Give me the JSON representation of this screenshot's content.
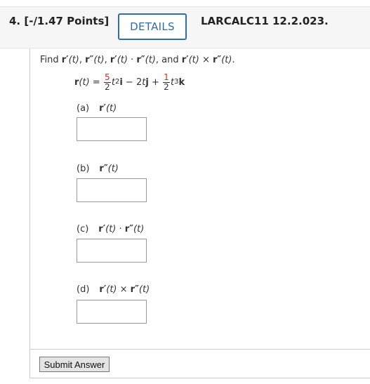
{
  "header": {
    "question_number": "4.",
    "points": "[-/1.47 Points]",
    "details_label": "DETAILS",
    "assignment_id": "LARCALC11 12.2.023."
  },
  "problem": {
    "find_prefix": "Find ",
    "find_mid1": ", ",
    "find_mid2": ", ",
    "find_mid3": ", and ",
    "find_end": ".",
    "r1": "r′",
    "r2": "r″",
    "t_arg": "(t)",
    "dot": " · ",
    "cross": " × ",
    "formula": {
      "lhs_r": "r",
      "lhs_t": "(t)",
      "equals": " = ",
      "frac1_num": "5",
      "frac1_den": "2",
      "t": "t",
      "exp2": "2",
      "i": "i",
      "minus": " − 2",
      "t2": "t",
      "j": "j",
      "plus": " + ",
      "frac2_num": "1",
      "frac2_den": "2",
      "t3": "t",
      "exp3": "3",
      "k": "k"
    }
  },
  "parts": [
    {
      "label": "(a)",
      "expr_r1": "r′",
      "expr_t": "(t)"
    },
    {
      "label": "(b)",
      "expr_r1": "r″",
      "expr_t": "(t)"
    },
    {
      "label": "(c)",
      "expr_r1": "r′",
      "expr_t1": "(t)",
      "op": " · ",
      "expr_r2": "r″",
      "expr_t2": "(t)"
    },
    {
      "label": "(d)",
      "expr_r1": "r′",
      "expr_t1": "(t)",
      "op": " × ",
      "expr_r2": "r″",
      "expr_t2": "(t)"
    }
  ],
  "submit_label": "Submit Answer",
  "colors": {
    "accent": "#2f6ea3",
    "header_bg": "#f6f6f6",
    "fraction_highlight": "#dd2222"
  }
}
